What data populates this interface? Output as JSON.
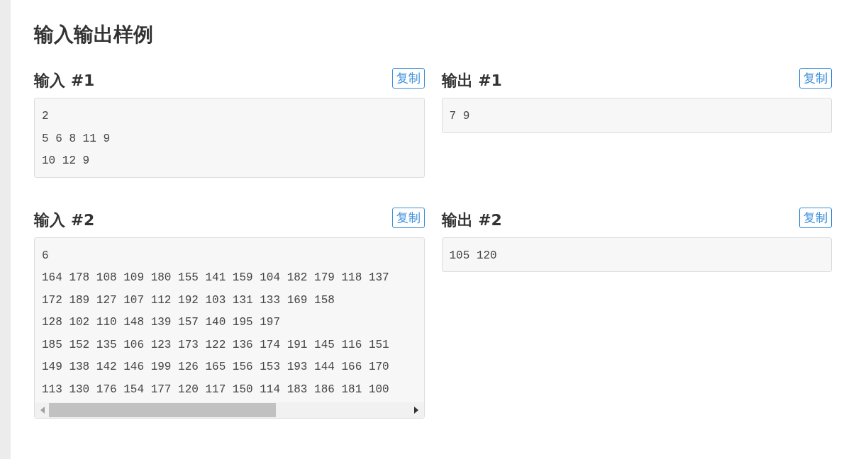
{
  "section": {
    "title": "输入输出样例"
  },
  "examples": [
    {
      "input": {
        "heading": "输入 #1",
        "copy_button": "复制",
        "horizontal_scrollbar": false,
        "lines": [
          "2",
          "5 6 8 11 9",
          "10 12 9"
        ]
      },
      "output": {
        "heading": "输出 #1",
        "copy_button": "复制",
        "horizontal_scrollbar": false,
        "lines": [
          "7 9"
        ]
      }
    },
    {
      "input": {
        "heading": "输入 #2",
        "copy_button": "复制",
        "horizontal_scrollbar": true,
        "lines": [
          "6",
          "164 178 108 109 180 155 141 159 104 182 179 118 137",
          "172 189 127 107 112 192 103 131 133 169 158",
          "128 102 110 148 139 157 140 195 197",
          "185 152 135 106 123 173 122 136 174 191 145 116 151",
          "149 138 142 146 199 126 165 156 153 193 144 166 170",
          "113 130 176 154 177 120 117 150 114 183 186 181 100"
        ]
      },
      "output": {
        "heading": "输出 #2",
        "copy_button": "复制",
        "horizontal_scrollbar": false,
        "lines": [
          "105 120"
        ]
      }
    }
  ]
}
